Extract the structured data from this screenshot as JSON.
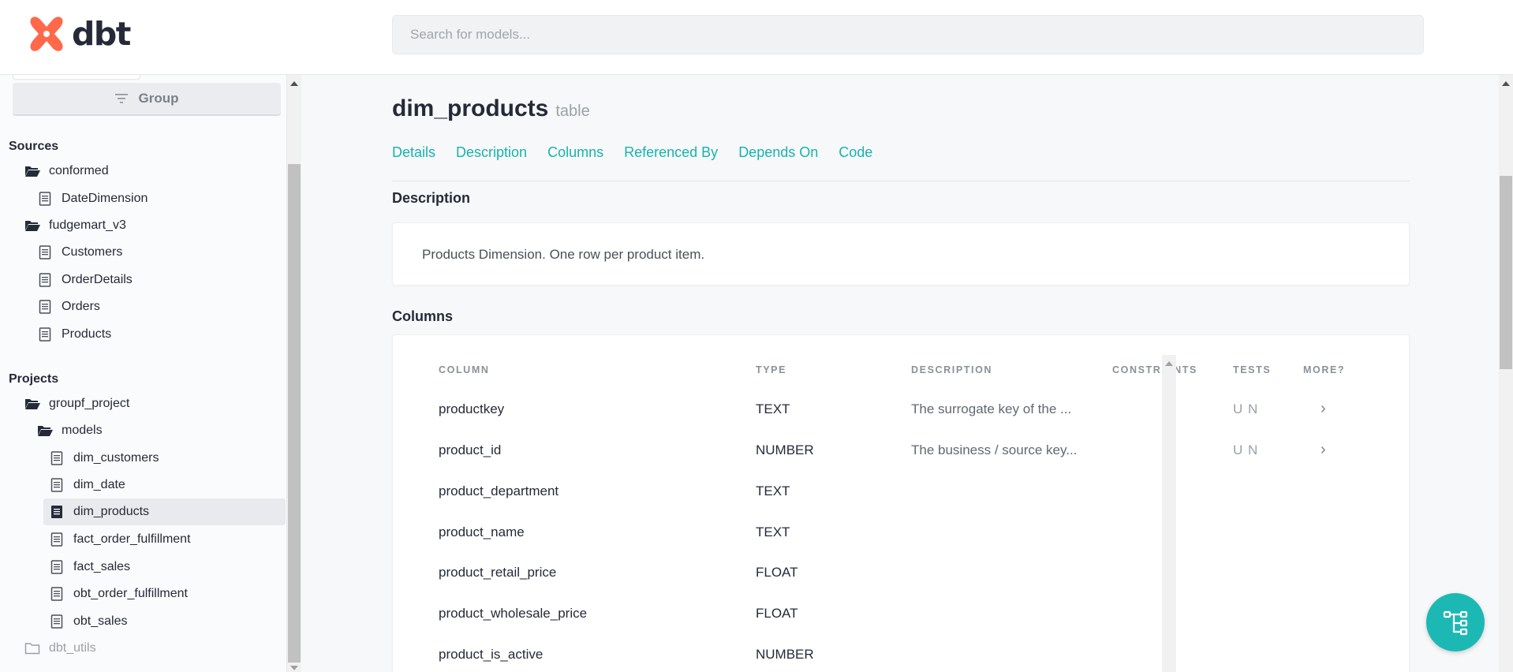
{
  "app": {
    "logo_text": "dbt"
  },
  "search": {
    "placeholder": "Search for models..."
  },
  "sidebar": {
    "group_label": "Group",
    "sources_label": "Sources",
    "projects_label": "Projects",
    "sources": [
      {
        "label": "conformed",
        "kind": "folder-open"
      },
      {
        "label": "DateDimension",
        "kind": "file"
      },
      {
        "label": "fudgemart_v3",
        "kind": "folder-open"
      },
      {
        "label": "Customers",
        "kind": "file"
      },
      {
        "label": "OrderDetails",
        "kind": "file"
      },
      {
        "label": "Orders",
        "kind": "file"
      },
      {
        "label": "Products",
        "kind": "file"
      }
    ],
    "projects": [
      {
        "label": "groupf_project",
        "kind": "folder-open"
      },
      {
        "label": "models",
        "kind": "folder-open"
      },
      {
        "label": "dim_customers",
        "kind": "file"
      },
      {
        "label": "dim_date",
        "kind": "file"
      },
      {
        "label": "dim_products",
        "kind": "file",
        "active": true
      },
      {
        "label": "fact_order_fulfillment",
        "kind": "file"
      },
      {
        "label": "fact_sales",
        "kind": "file"
      },
      {
        "label": "obt_order_fulfillment",
        "kind": "file"
      },
      {
        "label": "obt_sales",
        "kind": "file"
      },
      {
        "label": "dbt_utils",
        "kind": "folder-closed"
      }
    ]
  },
  "model": {
    "name": "dim_products",
    "kind": "table",
    "tabs": [
      "Details",
      "Description",
      "Columns",
      "Referenced By",
      "Depends On",
      "Code"
    ],
    "description_title": "Description",
    "description": "Products Dimension. One row per product item.",
    "columns_title": "Columns"
  },
  "columns_table": {
    "headers": [
      "COLUMN",
      "TYPE",
      "DESCRIPTION",
      "CONSTRAINTS",
      "TESTS",
      "MORE?"
    ],
    "rows": [
      {
        "column": "productkey",
        "type": "TEXT",
        "description": "The surrogate key of the ...",
        "constraints": "",
        "tests": "U N",
        "more": "›"
      },
      {
        "column": "product_id",
        "type": "NUMBER",
        "description": "The business / source key...",
        "constraints": "",
        "tests": "U N",
        "more": "›"
      },
      {
        "column": "product_department",
        "type": "TEXT",
        "description": "",
        "constraints": "",
        "tests": "",
        "more": ""
      },
      {
        "column": "product_name",
        "type": "TEXT",
        "description": "",
        "constraints": "",
        "tests": "",
        "more": ""
      },
      {
        "column": "product_retail_price",
        "type": "FLOAT",
        "description": "",
        "constraints": "",
        "tests": "",
        "more": ""
      },
      {
        "column": "product_wholesale_price",
        "type": "FLOAT",
        "description": "",
        "constraints": "",
        "tests": "",
        "more": ""
      },
      {
        "column": "product_is_active",
        "type": "NUMBER",
        "description": "",
        "constraints": "",
        "tests": "",
        "more": ""
      }
    ]
  },
  "colors": {
    "accent": "#16b3b0",
    "brand": "#ff694a",
    "fab": "#1cb9b4"
  },
  "icons": {
    "fab": "lineage-graph-icon",
    "group": "filter-lines-icon"
  }
}
